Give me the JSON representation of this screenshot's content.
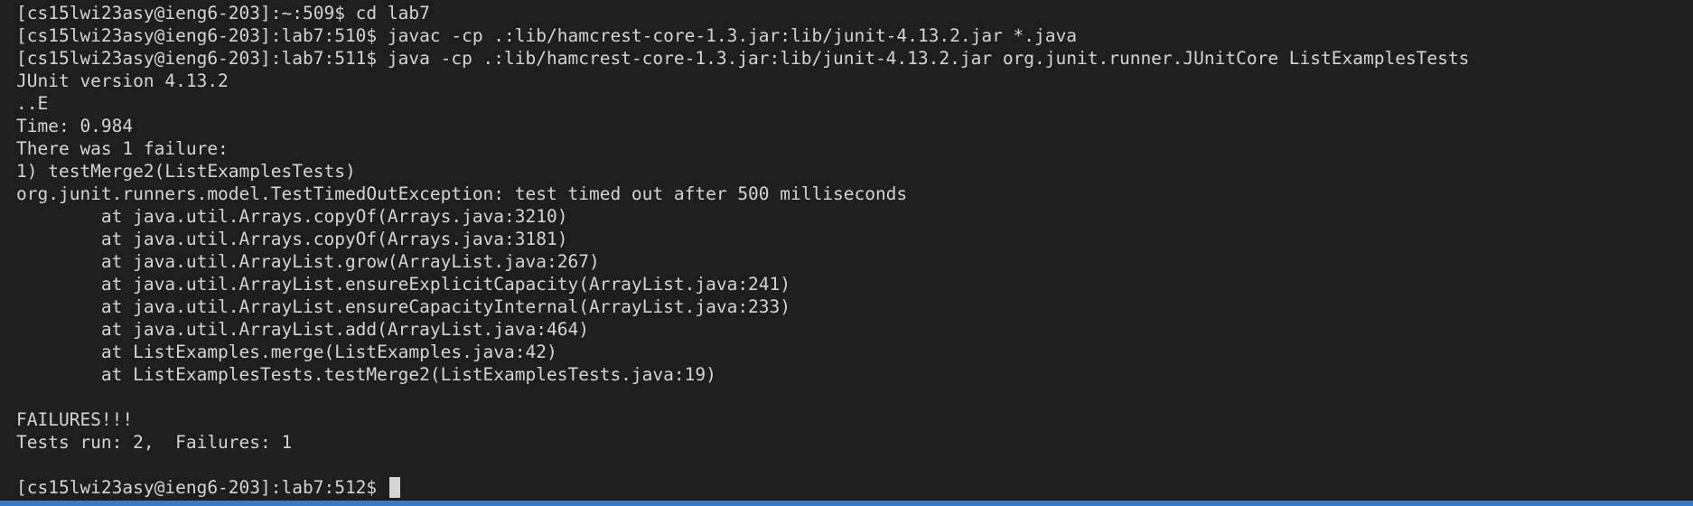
{
  "terminal": {
    "lines": [
      "[cs15lwi23asy@ieng6-203]:~:509$ cd lab7",
      "[cs15lwi23asy@ieng6-203]:lab7:510$ javac -cp .:lib/hamcrest-core-1.3.jar:lib/junit-4.13.2.jar *.java",
      "[cs15lwi23asy@ieng6-203]:lab7:511$ java -cp .:lib/hamcrest-core-1.3.jar:lib/junit-4.13.2.jar org.junit.runner.JUnitCore ListExamplesTests",
      "JUnit version 4.13.2",
      "..E",
      "Time: 0.984",
      "There was 1 failure:",
      "1) testMerge2(ListExamplesTests)",
      "org.junit.runners.model.TestTimedOutException: test timed out after 500 milliseconds",
      "        at java.util.Arrays.copyOf(Arrays.java:3210)",
      "        at java.util.Arrays.copyOf(Arrays.java:3181)",
      "        at java.util.ArrayList.grow(ArrayList.java:267)",
      "        at java.util.ArrayList.ensureExplicitCapacity(ArrayList.java:241)",
      "        at java.util.ArrayList.ensureCapacityInternal(ArrayList.java:233)",
      "        at java.util.ArrayList.add(ArrayList.java:464)",
      "        at ListExamples.merge(ListExamples.java:42)",
      "        at ListExamplesTests.testMerge2(ListExamplesTests.java:19)",
      "",
      "FAILURES!!!",
      "Tests run: 2,  Failures: 1",
      ""
    ],
    "prompt": "[cs15lwi23asy@ieng6-203]:lab7:512$ ",
    "colors": {
      "background": "#1e1e1e",
      "foreground": "#d4d4d4",
      "status_bar": "#3b78c8"
    }
  }
}
